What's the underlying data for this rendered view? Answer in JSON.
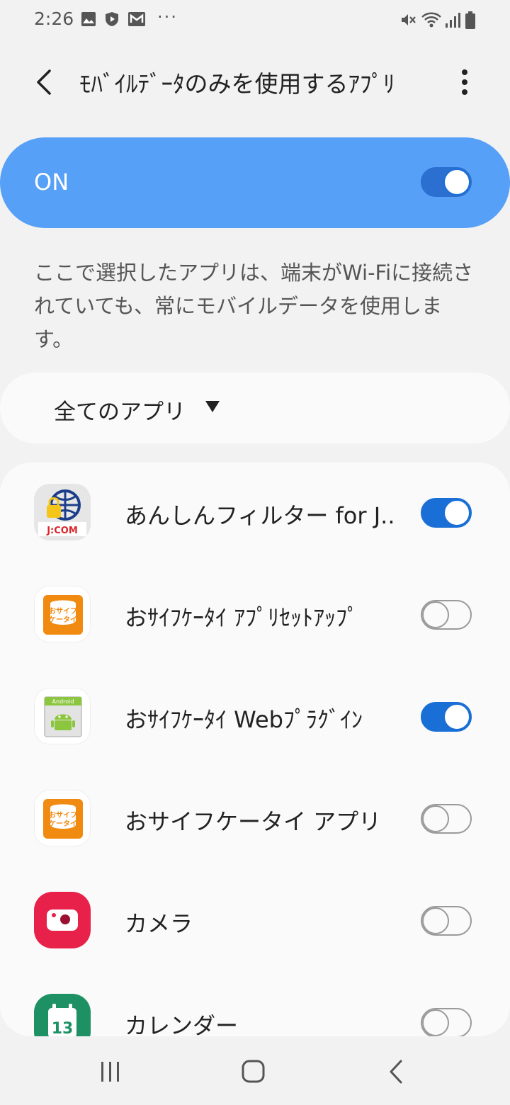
{
  "status_bar": {
    "time": "2:26",
    "dots": "···",
    "icons": [
      "image-icon",
      "shield-icon",
      "mail-icon",
      "mute-icon",
      "wifi-icon",
      "signal-icon",
      "battery-icon"
    ]
  },
  "header": {
    "title": "ﾓﾊﾞｲﾙﾃﾞｰﾀのみを使用するｱﾌﾟﾘ",
    "back_icon": "back-arrow-icon",
    "more_icon": "more-vert-icon"
  },
  "master": {
    "label": "ON",
    "enabled": true,
    "color": "#56a0f7"
  },
  "description": "ここで選択したアプリは、端末がWi-Fiに接続されていても、常にモバイルデータを使用します。",
  "filter": {
    "label": "全てのアプリ",
    "icon": "dropdown-triangle-icon"
  },
  "apps": [
    {
      "label": "あんしんフィルター for J..",
      "enabled": true,
      "icon": "jcom-filter-icon"
    },
    {
      "label": "おｻｲﾌｹｰﾀｲ ｱﾌﾟﾘｾｯﾄｱｯﾌﾟ",
      "enabled": false,
      "icon": "osaifu-icon"
    },
    {
      "label": "おｻｲﾌｹｰﾀｲ Webﾌﾟﾗｸﾞｲﾝ",
      "enabled": true,
      "icon": "android-plugin-icon"
    },
    {
      "label": "おサイフケータイ アプリ",
      "enabled": false,
      "icon": "osaifu-icon"
    },
    {
      "label": "カメラ",
      "enabled": false,
      "icon": "camera-icon"
    },
    {
      "label": "カレンダー",
      "enabled": false,
      "icon": "calendar-icon"
    }
  ],
  "app_icon_text": {
    "jcom": "J:COM",
    "osaifu": "おサイフ",
    "osaifu_sub": "ケータイ",
    "android_plugin": "Android",
    "calendar_day": "13"
  },
  "nav": {
    "icons": [
      "recent-apps-icon",
      "home-icon",
      "back-icon"
    ]
  }
}
